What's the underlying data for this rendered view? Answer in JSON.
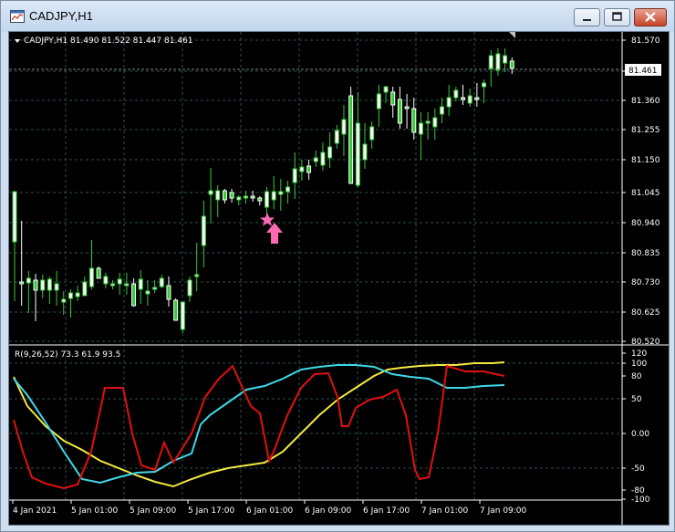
{
  "window": {
    "title": "CADJPY,H1"
  },
  "colors": {
    "bull": "#32cd32",
    "bear": "#ffffff",
    "grid": "#2f4f4f",
    "rsi_red": "#e01010",
    "rsi_cyan": "#40d8e8",
    "rsi_yellow": "#f4ea40",
    "signal_pink": "#ff69b4",
    "axis_text": "#ffffff"
  },
  "price_panel": {
    "header": "CADJPY,H1  81.490 81.522 81.447 81.461",
    "price_labels": [
      "81.570",
      "81.465",
      "81.360",
      "81.255",
      "81.150",
      "81.045",
      "80.940",
      "80.835",
      "80.730",
      "80.625",
      "80.520"
    ],
    "current_price": "81.461",
    "signal": {
      "star_icon": "star-icon",
      "arrow_icon": "arrow-up-icon"
    }
  },
  "indicator_panel": {
    "header": "R(9,26,52) 73.3 61.9 93.5",
    "labels": [
      "120",
      "100",
      "80",
      "50",
      "0.00",
      "-50",
      "-80",
      "-100"
    ]
  },
  "time_labels": [
    "4 Jan 2021",
    "5 Jan 01:00",
    "5 Jan 09:00",
    "5 Jan 17:00",
    "6 Jan 01:00",
    "6 Jan 09:00",
    "6 Jan 17:00",
    "7 Jan 01:00",
    "7 Jan 09:00"
  ]
}
